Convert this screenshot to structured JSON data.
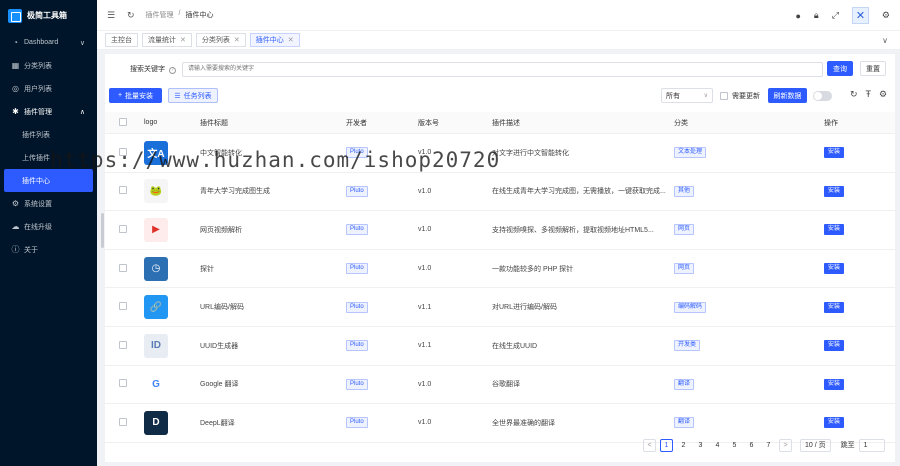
{
  "app": {
    "brand": "极简工具箱"
  },
  "sidebar": {
    "items": [
      {
        "label": "Dashboard",
        "icon": "dashboard-icon",
        "arrow": "∨"
      },
      {
        "label": "分类列表",
        "icon": "folder-icon"
      },
      {
        "label": "用户列表",
        "icon": "user-icon"
      },
      {
        "label": "插件管理",
        "icon": "puzzle-icon",
        "arrow": "∧"
      },
      {
        "label": "插件列表",
        "sub": true
      },
      {
        "label": "上传插件",
        "sub": true
      },
      {
        "label": "插件中心",
        "sub": true,
        "active": true
      },
      {
        "label": "系统设置",
        "icon": "gear-icon"
      },
      {
        "label": "在线升级",
        "icon": "cloud-icon"
      },
      {
        "label": "关于",
        "icon": "info-icon"
      }
    ]
  },
  "header": {
    "breadcrumb": [
      "插件管理",
      "/",
      "插件中心"
    ]
  },
  "tabs": [
    {
      "label": "主控台",
      "closable": false
    },
    {
      "label": "流量统计",
      "closable": true
    },
    {
      "label": "分类列表",
      "closable": true
    },
    {
      "label": "插件中心",
      "closable": true,
      "active": true
    }
  ],
  "search": {
    "label": "搜索关键字",
    "placeholder": "请输入需要搜索的关键字",
    "search_btn": "查询",
    "reset_btn": "重置"
  },
  "toolbar": {
    "batch_install": "批量安装",
    "task_list": "任务列表",
    "filter_value": "所有",
    "need_update_label": "需要更新",
    "refresh_data": "刷新数据"
  },
  "table": {
    "headers": [
      "logo",
      "插件标题",
      "开发者",
      "版本号",
      "插件描述",
      "分类",
      "操作"
    ],
    "rows": [
      {
        "title": "中文智能转化",
        "dev": "Pluto",
        "ver": "v1.0",
        "desc": "对文字进行中文智能转化",
        "cat": "文本处理",
        "op": "安装",
        "logo_color": "#1a6fd8",
        "logo_glyph": "文A"
      },
      {
        "title": "青年大学习完成图生成",
        "dev": "Pluto",
        "ver": "v1.0",
        "desc": "在线生成青年大学习完成图，无需播放，一键获取完成...",
        "cat": "其他",
        "op": "安装",
        "logo_color": "#f5f5f5",
        "logo_glyph": "🐸"
      },
      {
        "title": "网页视频解析",
        "dev": "Pluto",
        "ver": "v1.0",
        "desc": "支持视频嗅探、多视频解析，提取视频地址HTML5...",
        "cat": "网页",
        "op": "安装",
        "logo_color": "#fdeceb",
        "logo_glyph": "▶"
      },
      {
        "title": "探针",
        "dev": "Pluto",
        "ver": "v1.0",
        "desc": "一款功能较多的 PHP 探针",
        "cat": "网页",
        "op": "安装",
        "logo_color": "#2c6fb3",
        "logo_glyph": "◷"
      },
      {
        "title": "URL编码/解码",
        "dev": "Pluto",
        "ver": "v1.1",
        "desc": "对URL进行编码/解码",
        "cat": "编码解码",
        "op": "安装",
        "logo_color": "#2196f3",
        "logo_glyph": "🔗"
      },
      {
        "title": "UUID生成器",
        "dev": "Pluto",
        "ver": "v1.1",
        "desc": "在线生成UUID",
        "cat": "开发类",
        "op": "安装",
        "logo_color": "#e8ecf3",
        "logo_glyph": "ID"
      },
      {
        "title": "Google 翻译",
        "dev": "Pluto",
        "ver": "v1.0",
        "desc": "谷歌翻译",
        "cat": "翻译",
        "op": "安装",
        "logo_color": "#ffffff",
        "logo_glyph": "G"
      },
      {
        "title": "DeepL翻译",
        "dev": "Pluto",
        "ver": "v1.0",
        "desc": "全世界最准确的翻译",
        "cat": "翻译",
        "op": "安装",
        "logo_color": "#0f2b46",
        "logo_glyph": "D"
      }
    ]
  },
  "pagination": {
    "pages": [
      "1",
      "2",
      "3",
      "4",
      "5",
      "6",
      "7"
    ],
    "current": "1",
    "prev": "<",
    "next": ">",
    "page_size": "10 / 页",
    "goto_label": "跳至",
    "goto_value": "1"
  },
  "watermark": "https://www.huzhan.com/ishop20720",
  "colors": {
    "primary": "#2d5bff",
    "sidebar_bg": "#001529"
  }
}
